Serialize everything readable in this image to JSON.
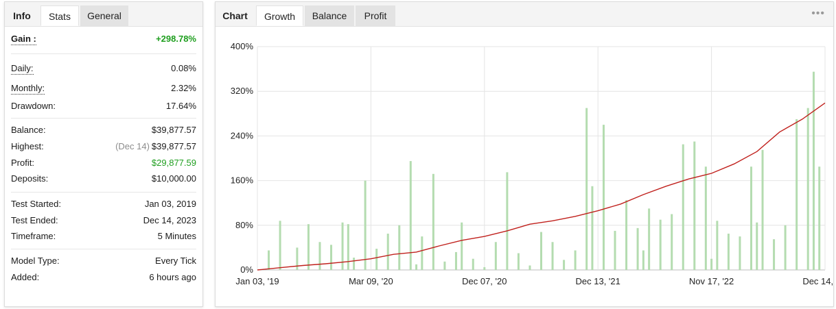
{
  "stats_panel": {
    "tabs": [
      {
        "label": "Info"
      },
      {
        "label": "Stats"
      },
      {
        "label": "General"
      }
    ],
    "gain": {
      "label": "Gain :",
      "value": "+298.78%"
    },
    "daily": {
      "label": "Daily:",
      "value": "0.08%"
    },
    "monthly": {
      "label": "Monthly:",
      "value": "2.32%"
    },
    "drawdown": {
      "label": "Drawdown:",
      "value": "17.64%"
    },
    "balance": {
      "label": "Balance:",
      "value": "$39,877.57"
    },
    "highest": {
      "label": "Highest:",
      "date": "(Dec 14)",
      "value": "$39,877.57"
    },
    "profit": {
      "label": "Profit:",
      "value": "$29,877.59"
    },
    "deposits": {
      "label": "Deposits:",
      "value": "$10,000.00"
    },
    "test_started": {
      "label": "Test Started:",
      "value": "Jan 03, 2019"
    },
    "test_ended": {
      "label": "Test Ended:",
      "value": "Dec 14, 2023"
    },
    "timeframe": {
      "label": "Timeframe:",
      "value": "5 Minutes"
    },
    "model_type": {
      "label": "Model Type:",
      "value": "Every Tick"
    },
    "added": {
      "label": "Added:",
      "value": "6 hours ago"
    }
  },
  "chart_panel": {
    "tabs": [
      {
        "label": "Chart"
      },
      {
        "label": "Growth"
      },
      {
        "label": "Balance"
      },
      {
        "label": "Profit"
      }
    ],
    "menu_icon": "more-dots-icon",
    "menu_glyph": "•••"
  },
  "colors": {
    "line": "#c0201c",
    "bars": "#b4dcb0",
    "gain_green": "#1e9e1e",
    "grid": "#e4e4e4"
  },
  "chart_data": {
    "type": "line",
    "title": "",
    "xlabel": "",
    "ylabel": "",
    "ylim": [
      0,
      400
    ],
    "y_ticks": [
      "0%",
      "80%",
      "160%",
      "240%",
      "320%",
      "400%"
    ],
    "y_tick_values": [
      0,
      80,
      160,
      240,
      320,
      400
    ],
    "x_ticks": [
      "Jan 03, '19",
      "Mar 09, '20",
      "Dec 07, '20",
      "Dec 13, '21",
      "Nov 17, '22",
      "Dec 14, '23"
    ],
    "grid": true,
    "series": [
      {
        "kind": "line",
        "x": [
          0,
          4,
          8,
          12,
          16,
          20,
          24,
          28,
          32,
          36,
          40,
          44,
          48,
          52,
          56,
          60,
          64,
          68,
          72,
          76,
          80,
          84,
          88,
          92,
          96,
          100
        ],
        "values": [
          0,
          4,
          8,
          11,
          15,
          20,
          28,
          32,
          43,
          53,
          60,
          70,
          82,
          88,
          96,
          106,
          118,
          135,
          150,
          163,
          173,
          190,
          212,
          247,
          270,
          299
        ]
      },
      {
        "kind": "bar",
        "x": [
          2,
          4,
          7,
          9,
          11,
          13,
          15,
          16,
          17,
          19,
          21,
          23,
          25,
          27,
          28,
          29,
          31,
          33,
          35,
          36,
          38,
          40,
          42,
          44,
          46,
          48,
          50,
          52,
          54,
          56,
          58,
          59,
          61,
          63,
          65,
          67,
          68,
          69,
          71,
          73,
          75,
          77,
          79,
          80,
          81,
          83,
          85,
          87,
          88,
          89,
          91,
          93,
          95,
          97,
          98,
          99
        ],
        "values": [
          35,
          88,
          40,
          82,
          50,
          45,
          85,
          82,
          22,
          160,
          38,
          65,
          80,
          195,
          10,
          60,
          172,
          15,
          32,
          85,
          20,
          5,
          50,
          175,
          30,
          8,
          68,
          50,
          18,
          35,
          290,
          150,
          260,
          70,
          125,
          75,
          35,
          110,
          90,
          100,
          225,
          230,
          185,
          20,
          88,
          65,
          60,
          185,
          85,
          215,
          55,
          80,
          270,
          290,
          355,
          185
        ]
      }
    ]
  }
}
